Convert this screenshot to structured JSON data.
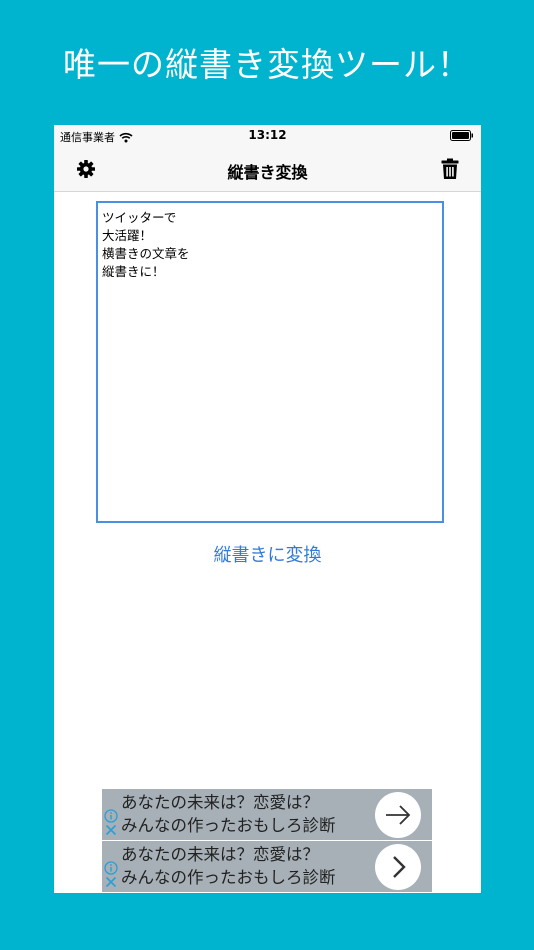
{
  "headline": "唯一の縦書き変換ツール！",
  "status_bar": {
    "carrier": "通信事業者",
    "time": "13:12"
  },
  "nav": {
    "title": "縦書き変換",
    "settings_icon": "gear-icon",
    "trash_icon": "trash-icon"
  },
  "editor": {
    "text": "ツイッターで\n大活躍！\n横書きの文章を\n縦書きに！"
  },
  "convert_button": "縦書きに変換",
  "ads": [
    {
      "line1": "あなたの未来は？恋愛は？",
      "line2": "みんなの作ったおもしろ診断",
      "cta_icon": "arrow-right-icon"
    },
    {
      "line1": "あなたの未来は？恋愛は？",
      "line2": "みんなの作ったおもしろ診断",
      "cta_icon": "chevron-right-icon"
    }
  ],
  "colors": {
    "background": "#00b4cf",
    "accent": "#2f7bd7",
    "editor_border": "#4a90e2",
    "ad_background": "#a7b0b7"
  }
}
